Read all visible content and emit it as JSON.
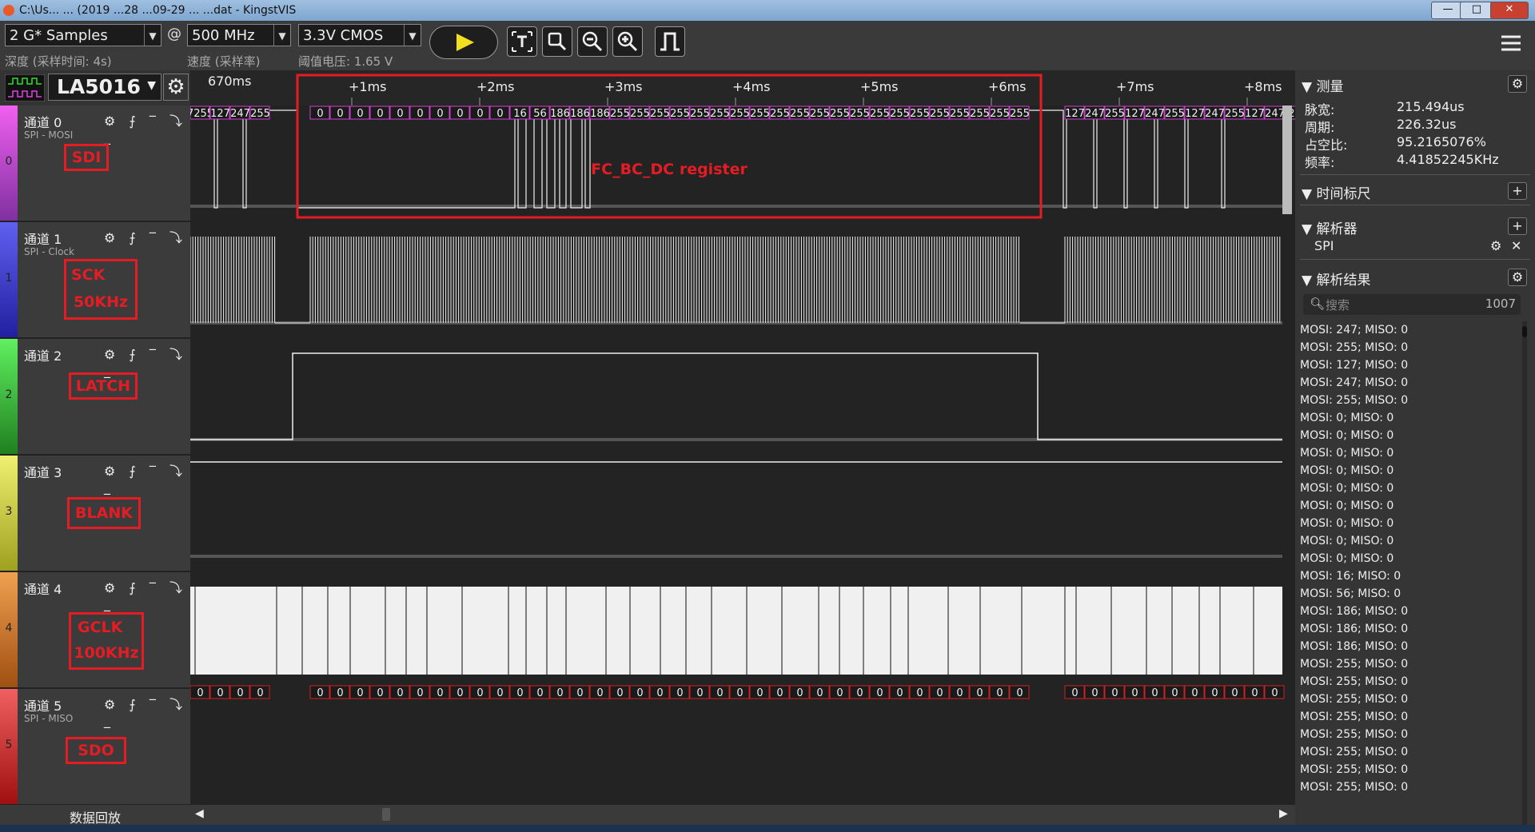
{
  "window": {
    "title": "C:\\Us...  ...  (2019 ...28 ...09-29 ...  ...dat - KingstVIS",
    "btn_min": "—",
    "btn_max": "□",
    "btn_close": "✕"
  },
  "toolbar": {
    "samples": "2 G* Samples",
    "at": "@",
    "rate": "500 MHz",
    "voltage": "3.3V CMOS",
    "depth_label": "深度 (采样时间: 4s)",
    "speed_label": "速度 (采样率)",
    "threshold_label": "阈值电压: 1.65 V",
    "icons": [
      "play-icon",
      "text-cursor-icon",
      "zoom-fit-icon",
      "zoom-out-icon",
      "zoom-in-icon",
      "pulse-icon",
      "menu-icon"
    ]
  },
  "device": {
    "name": "LA5016"
  },
  "time_axis": {
    "start": "670ms",
    "ticks": [
      "+1ms",
      "+2ms",
      "+3ms",
      "+4ms",
      "+5ms",
      "+6ms",
      "+7ms",
      "+8ms"
    ]
  },
  "channels": [
    {
      "name": "通道 0",
      "sub": "SPI - MOSI",
      "num": "0",
      "tag": "SDI",
      "color": "#c040c0"
    },
    {
      "name": "通道 1",
      "sub": "SPI - Clock",
      "num": "1",
      "tag1": "SCK",
      "tag2": "50KHz",
      "color": "#3030c0"
    },
    {
      "name": "通道 2",
      "sub": "",
      "num": "2",
      "tag": "LATCH",
      "color": "#20a020"
    },
    {
      "name": "通道 3",
      "sub": "",
      "num": "3",
      "tag": "BLANK",
      "color": "#d0d030"
    },
    {
      "name": "通道 4",
      "sub": "",
      "num": "4",
      "tag1": "GCLK",
      "tag2": "100KHz",
      "color": "#e08020"
    },
    {
      "name": "通道 5",
      "sub": "SPI - MISO",
      "num": "5",
      "tag": "SDO",
      "color": "#d02020"
    }
  ],
  "mosi_decode": {
    "left": [
      "7255",
      "127",
      "247",
      "255"
    ],
    "mid": [
      "0",
      "0",
      "0",
      "0",
      "0",
      "0",
      "0",
      "0",
      "0",
      "0",
      "16",
      "56",
      "186",
      "186",
      "186",
      "255",
      "255",
      "255",
      "255",
      "255",
      "255",
      "255",
      "255",
      "255",
      "255",
      "255",
      "255",
      "255",
      "255",
      "255",
      "255",
      "255",
      "255",
      "255",
      "255",
      "255"
    ],
    "right": [
      "127",
      "247",
      "255",
      "127",
      "247",
      "255",
      "127",
      "247",
      "255",
      "127",
      "247",
      "25"
    ]
  },
  "annotation": {
    "label": "FC_BC_DC register"
  },
  "measure": {
    "title": "测量",
    "rows": [
      {
        "k": "脉宽:",
        "v": "215.494us"
      },
      {
        "k": "周期:",
        "v": "226.32us"
      },
      {
        "k": "占空比:",
        "v": "95.2165076%"
      },
      {
        "k": "频率:",
        "v": "4.41852245KHz"
      }
    ]
  },
  "sections": {
    "timemark": "时间标尺",
    "analyzer": "解析器",
    "analyzer_item": "SPI",
    "results": "解析结果",
    "search_placeholder": "搜索",
    "count": "1007"
  },
  "results": [
    "MOSI: 247;  MISO: 0",
    "MOSI: 255;  MISO: 0",
    "MOSI: 127;  MISO: 0",
    "MOSI: 247;  MISO: 0",
    "MOSI: 255;  MISO: 0",
    "MOSI: 0;  MISO: 0",
    "MOSI: 0;  MISO: 0",
    "MOSI: 0;  MISO: 0",
    "MOSI: 0;  MISO: 0",
    "MOSI: 0;  MISO: 0",
    "MOSI: 0;  MISO: 0",
    "MOSI: 0;  MISO: 0",
    "MOSI: 0;  MISO: 0",
    "MOSI: 0;  MISO: 0",
    "MOSI: 16;  MISO: 0",
    "MOSI: 56;  MISO: 0",
    "MOSI: 186;  MISO: 0",
    "MOSI: 186;  MISO: 0",
    "MOSI: 186;  MISO: 0",
    "MOSI: 255;  MISO: 0",
    "MOSI: 255;  MISO: 0",
    "MOSI: 255;  MISO: 0",
    "MOSI: 255;  MISO: 0",
    "MOSI: 255;  MISO: 0",
    "MOSI: 255;  MISO: 0",
    "MOSI: 255;  MISO: 0",
    "MOSI: 255;  MISO: 0"
  ],
  "bottom": {
    "playback": "数据回放"
  }
}
